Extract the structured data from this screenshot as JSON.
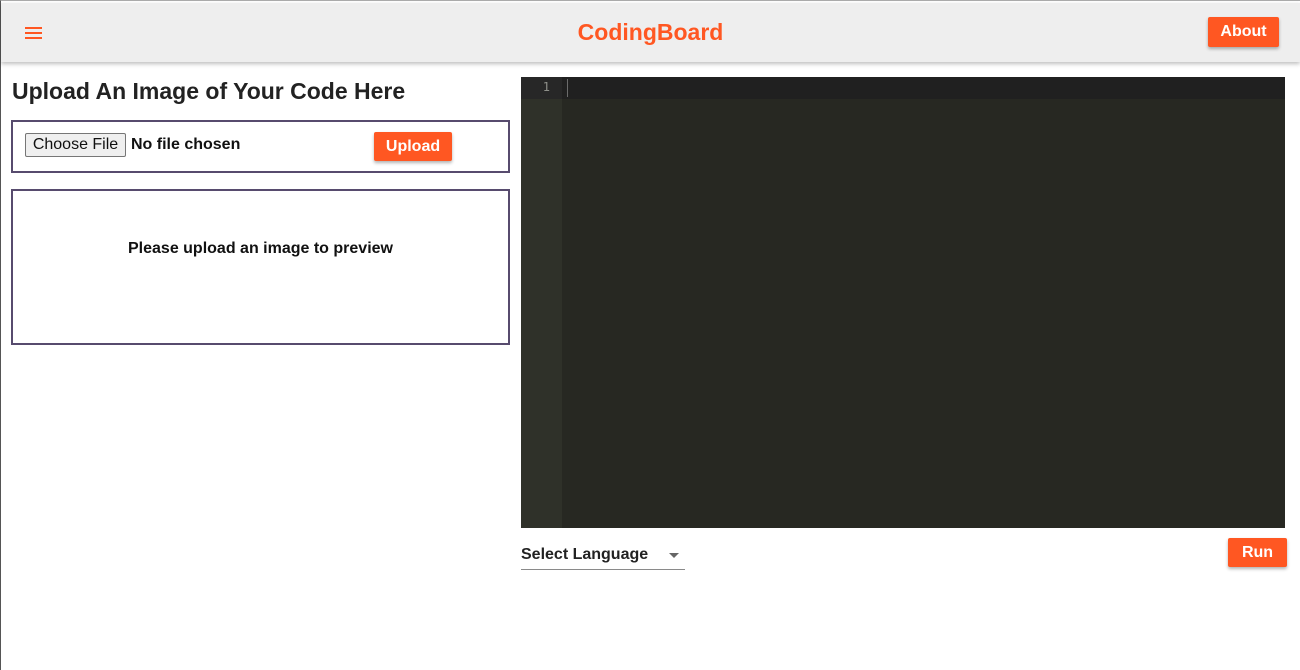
{
  "colors": {
    "accent": "#ff5722",
    "appbar_bg": "#eeeeee",
    "panel_border": "#574b6e",
    "editor_bg": "#272822",
    "gutter_bg": "#2f3129"
  },
  "header": {
    "menu_icon": "hamburger-menu-icon",
    "title": "CodingBoard",
    "about_label": "About"
  },
  "upload": {
    "heading": "Upload An Image of Your Code Here",
    "choose_file_label": "Choose File",
    "file_status": "No file chosen",
    "upload_label": "Upload"
  },
  "preview": {
    "placeholder": "Please upload an image to preview"
  },
  "editor": {
    "line_numbers": [
      "1"
    ],
    "content": ""
  },
  "controls": {
    "language_label": "Select Language",
    "language_arrow_icon": "caret-down-icon",
    "run_label": "Run"
  }
}
